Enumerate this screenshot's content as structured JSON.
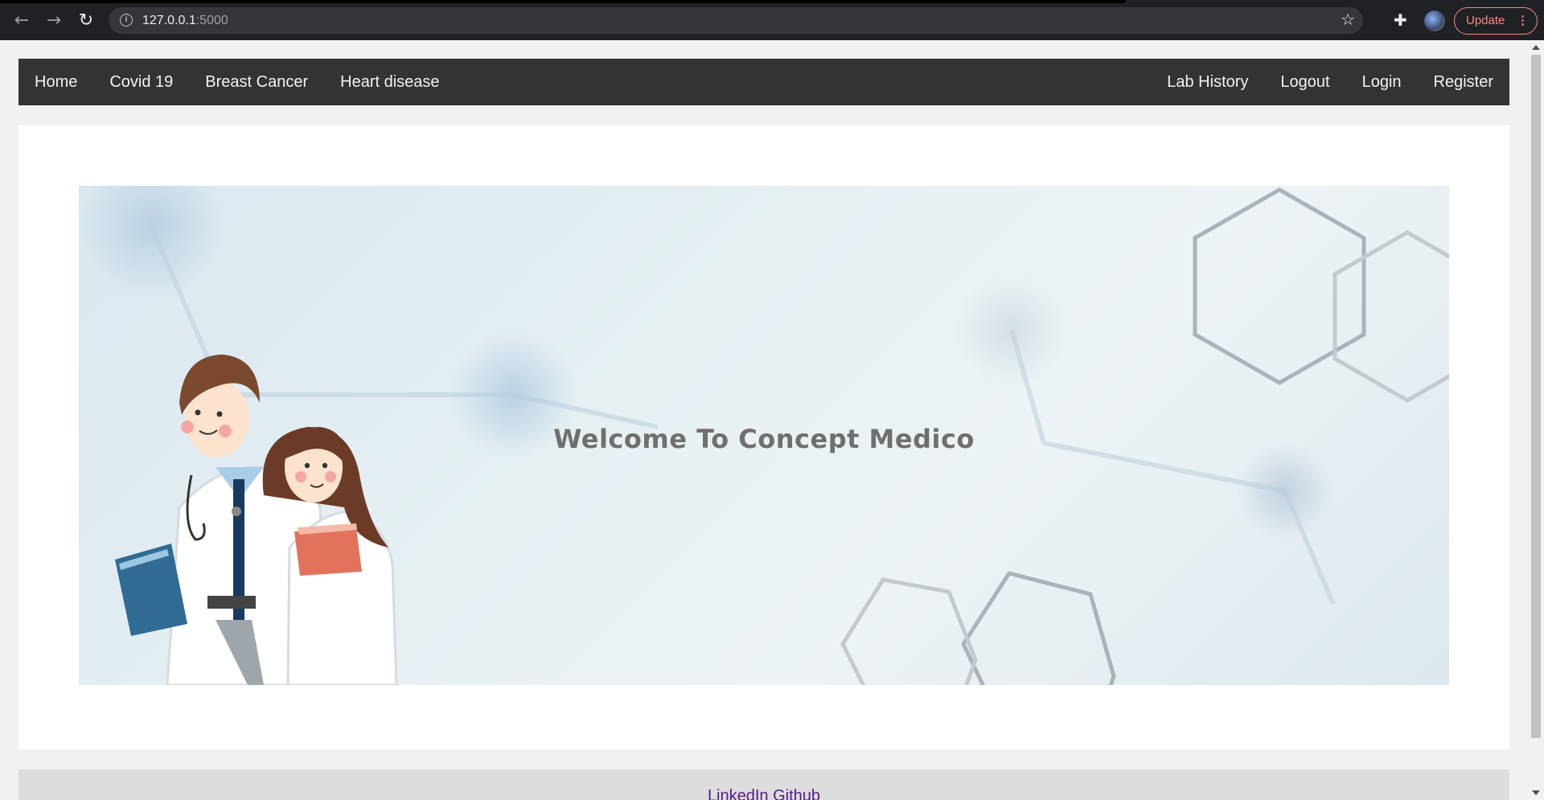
{
  "browser": {
    "url_host": "127.0.0.1",
    "url_port": ":5000",
    "update_label": "Update"
  },
  "nav": {
    "left": [
      "Home",
      "Covid 19",
      "Breast Cancer",
      "Heart disease"
    ],
    "right": [
      "Lab History",
      "Logout",
      "Login",
      "Register"
    ]
  },
  "hero": {
    "title": "Welcome To Concept Medico"
  },
  "footer": {
    "links": [
      "LinkedIn",
      "Github"
    ]
  }
}
